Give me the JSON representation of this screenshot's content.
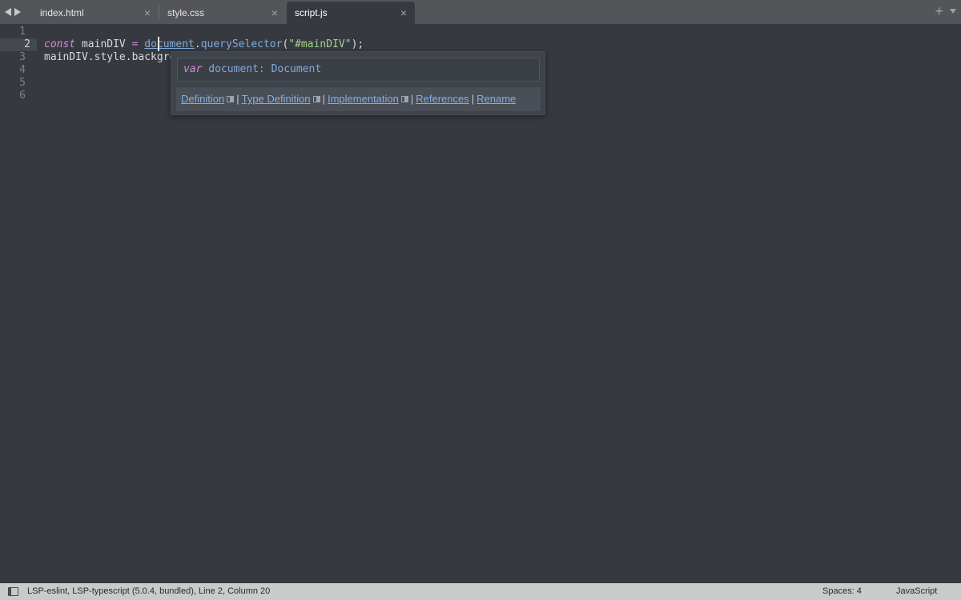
{
  "tabs": [
    {
      "label": "index.html",
      "close": "×",
      "active": false
    },
    {
      "label": "style.css",
      "close": "×",
      "active": false
    },
    {
      "label": "script.js",
      "close": "×",
      "active": true
    }
  ],
  "tabbar": {
    "add_tab": "+"
  },
  "editor": {
    "line_numbers": [
      "1",
      "2",
      "3",
      "4",
      "5",
      "6"
    ],
    "current_line": 2,
    "lines": {
      "line2": {
        "kw_const": "const",
        "var_name": " mainDIV ",
        "op_eq": "=",
        "space": " ",
        "doc": "document",
        "dot": ".",
        "method": "querySelector",
        "paren_open": "(",
        "string": "\"#mainDIV\"",
        "paren_close": ");"
      },
      "line3": "mainDIV.style.backgro"
    }
  },
  "hover_popup": {
    "signature_kw": "var",
    "signature_rest": " document: Document",
    "links": {
      "definition": "Definition",
      "type_definition": "Type Definition",
      "implementation": "Implementation",
      "references": "References",
      "rename": "Rename",
      "separator": "|"
    }
  },
  "statusbar": {
    "text": "LSP-eslint, LSP-typescript (5.0.4, bundled), Line 2, Column 20",
    "spaces": "Spaces: 4",
    "syntax": "JavaScript"
  },
  "colors": {
    "editor_bg": "#363a40",
    "tabbar_bg": "#535559",
    "keyword": "#d38cd6",
    "identifier": "#82aadb",
    "string": "#a6d08d",
    "link": "#7fb0e8",
    "statusbar_bg": "#c9cacc"
  }
}
